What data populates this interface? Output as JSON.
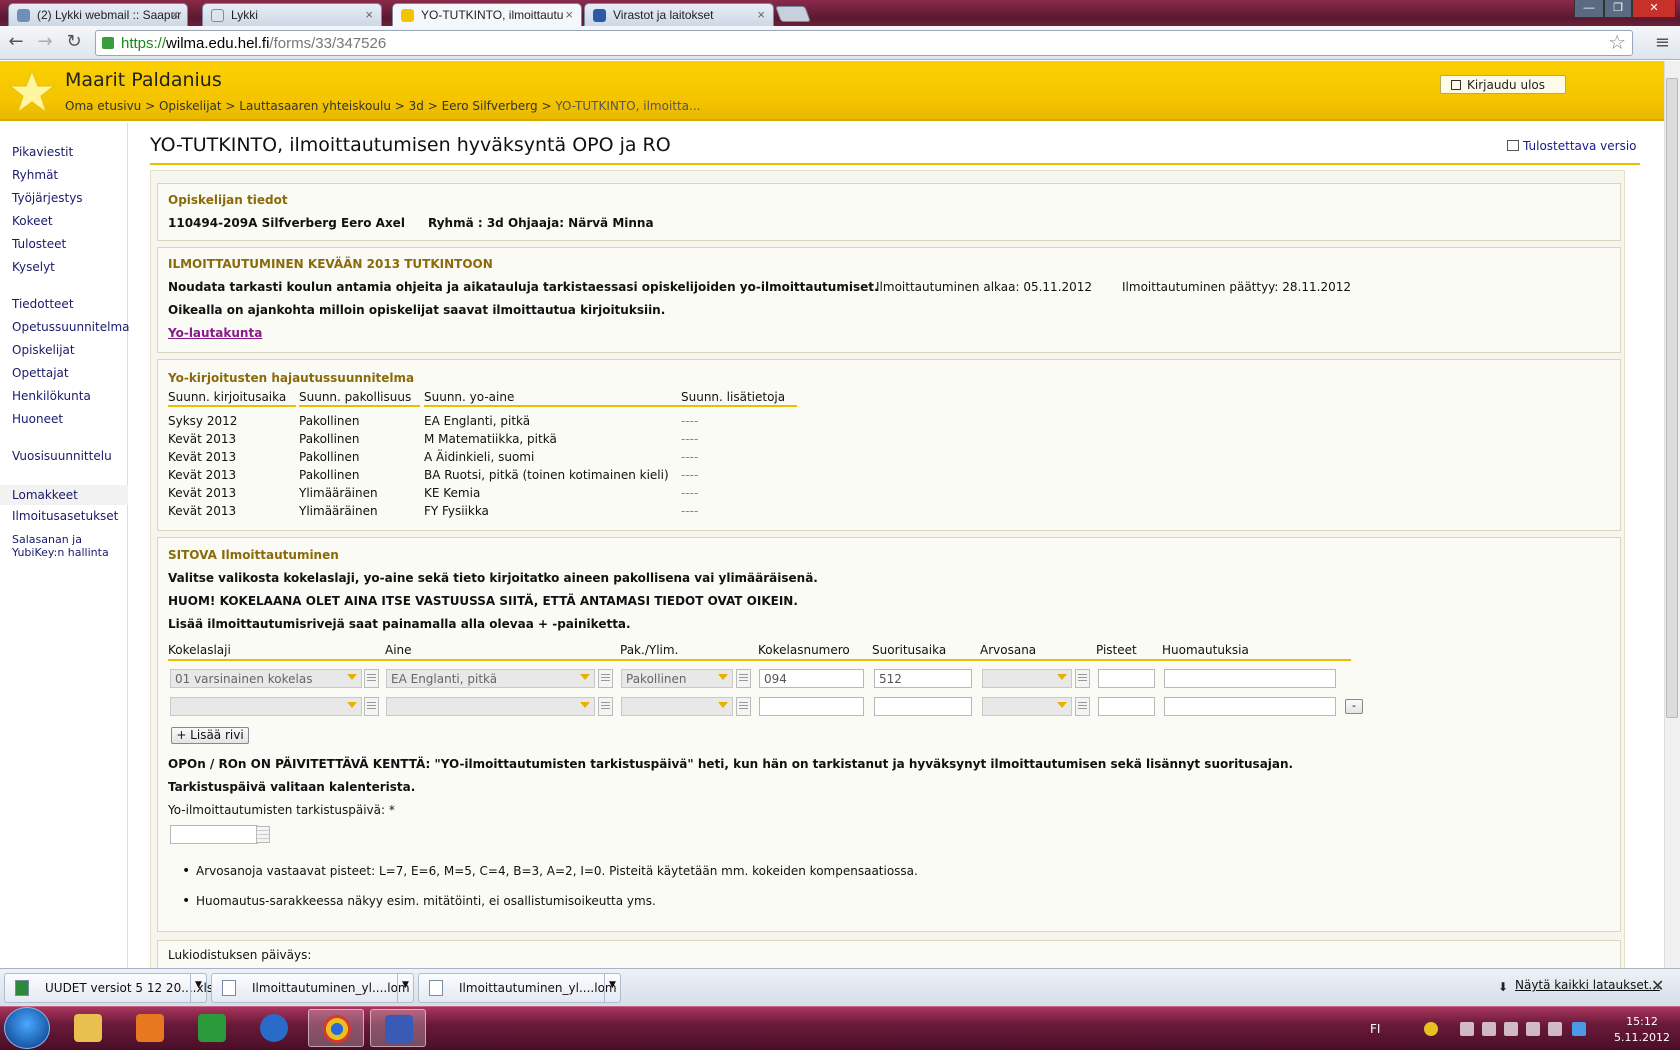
{
  "browser": {
    "tabs": [
      {
        "label": "(2) Lykki webmail :: Saapur",
        "active": false
      },
      {
        "label": "Lykki",
        "active": false
      },
      {
        "label": "YO-TUTKINTO, ilmoittautu",
        "active": true
      },
      {
        "label": "Virastot ja laitokset",
        "active": false
      }
    ],
    "url_scheme": "https://",
    "url_host": "wilma.edu.hel.fi",
    "url_path": "/forms/33/347526"
  },
  "header": {
    "user_name": "Maarit Paldanius",
    "breadcrumb": [
      "Oma etusivu",
      "Opiskelijat",
      "Lauttasaaren yhteiskoulu",
      "3d",
      "Eero Silfverberg",
      "YO-TUTKINTO, ilmoitta..."
    ],
    "logout_label": "Kirjaudu ulos"
  },
  "sidebar": {
    "items": [
      {
        "label": "Pikaviestit"
      },
      {
        "label": "Ryhmät"
      },
      {
        "label": "Työjärjestys"
      },
      {
        "label": "Kokeet"
      },
      {
        "label": "Tulosteet"
      },
      {
        "label": "Kyselyt"
      },
      {
        "label": "Tiedotteet"
      },
      {
        "label": "Opetussuunnitelma"
      },
      {
        "label": "Opiskelijat"
      },
      {
        "label": "Opettajat"
      },
      {
        "label": "Henkilökunta"
      },
      {
        "label": "Huoneet"
      },
      {
        "label": "Vuosisuunnittelu"
      },
      {
        "label": "Lomakkeet"
      },
      {
        "label": "Ilmoitusasetukset"
      },
      {
        "label": "Salasanan ja"
      },
      {
        "label": "YubiKey:n hallinta"
      }
    ]
  },
  "page": {
    "title": "YO-TUTKINTO, ilmoittautumisen hyväksyntä OPO ja RO",
    "print_label": "Tulostettava versio"
  },
  "student_panel": {
    "title": "Opiskelijan tiedot",
    "student": "110494-209A Silfverberg Eero Axel",
    "group": "Ryhmä : 3d Ohjaaja: Närvä Minna"
  },
  "registration_panel": {
    "title": "ILMOITTAUTUMINEN KEVÄÄN 2013 TUTKINTOON",
    "instruction": "Noudata tarkasti koulun antamia ohjeita ja aikatauluja tarkistaessasi opiskelijoiden yo-ilmoittautumiset.",
    "start": "Ilmoittautuminen alkaa: 05.11.2012",
    "end": "Ilmoittautuminen päättyy: 28.11.2012",
    "note": "Oikealla on ajankohta milloin opiskelijat saavat ilmoittautua kirjoituksiin.",
    "link": "Yo-lautakunta"
  },
  "plan_panel": {
    "title": "Yo-kirjoitusten hajautussuunnitelma",
    "columns": [
      "Suunn. kirjoitusaika",
      "Suunn. pakollisuus",
      "Suunn. yo-aine",
      "Suunn. lisätietoja"
    ],
    "rows": [
      [
        "Syksy 2012",
        "Pakollinen",
        "EA Englanti, pitkä",
        "----"
      ],
      [
        "Kevät 2013",
        "Pakollinen",
        "M Matematiikka, pitkä",
        "----"
      ],
      [
        "Kevät 2013",
        "Pakollinen",
        "A Äidinkieli, suomi",
        "----"
      ],
      [
        "Kevät 2013",
        "Pakollinen",
        "BA Ruotsi, pitkä (toinen kotimainen kieli)",
        "----"
      ],
      [
        "Kevät 2013",
        "Ylimääräinen",
        "KE Kemia",
        "----"
      ],
      [
        "Kevät 2013",
        "Ylimääräinen",
        "FY Fysiikka",
        "----"
      ]
    ]
  },
  "binding_panel": {
    "title": "SITOVA Ilmoittautuminen",
    "line1": "Valitse valikosta kokelaslaji, yo-aine sekä tieto kirjoitatko aineen pakollisena vai ylimääräisenä.",
    "line2": "HUOM! KOKELAANA OLET AINA ITSE VASTUUSSA SIITÄ, ETTÄ ANTAMASI TIEDOT OVAT OIKEIN.",
    "line3": "Lisää ilmoittautumisrivejä saat painamalla alla olevaa + -painiketta.",
    "columns": [
      "Kokelaslaji",
      "Aine",
      "Pak./Ylim.",
      "Kokelasnumero",
      "Suoritusaika",
      "Arvosana",
      "Pisteet",
      "Huomautuksia"
    ],
    "row1": {
      "kokelaslaji": "01 varsinainen kokelas",
      "aine": "EA Englanti, pitkä",
      "pak": "Pakollinen",
      "kokelasnumero": "094",
      "suoritusaika": "512",
      "arvosana": "",
      "pisteet": "",
      "huomautuksia": ""
    },
    "row2": {
      "kokelaslaji": "",
      "aine": "",
      "pak": "",
      "kokelasnumero": "",
      "suoritusaika": "",
      "arvosana": "",
      "pisteet": "",
      "huomautuksia": ""
    },
    "remove_label": "-",
    "add_row_label": "+ Lisää rivi",
    "opo_note": "OPOn / ROn ON PÄIVITETTÄVÄ KENTTÄ: \"YO-ilmoittautumisten tarkistuspäivä\" heti, kun hän on tarkistanut ja hyväksynyt ilmoittautumisen sekä lisännyt suoritusajan.",
    "calendar_note": "Tarkistuspäivä valitaan kalenterista.",
    "date_label": "Yo-ilmoittautumisten tarkistuspäivä: *",
    "date_value": "",
    "bullets": [
      "Arvosanoja vastaavat pisteet: L=7, E=6, M=5, C=4, B=3, A=2, I=0. Pisteitä käytetään mm. kokeiden kompensaatiossa.",
      "Huomautus-sarakkeessa näkyy esim. mitätöinti, ei osallistumisoikeutta yms."
    ]
  },
  "lukio_label": "Lukiodistuksen päiväys:",
  "downloads": {
    "items": [
      "UUDET versiot 5 12 20....xls",
      "Ilmoittautuminen_yl....lom",
      "Ilmoittautuminen_yl....lom"
    ],
    "show_all": "Näytä kaikki lataukset..."
  },
  "taskbar": {
    "lang": "FI",
    "time": "15:12",
    "date": "5.11.2012"
  },
  "colors": {
    "header_yellow": "#f4c400",
    "section_title": "#8a6a0a",
    "link_purple": "#8a1a8a",
    "taskbar": "#6a1a3a"
  }
}
